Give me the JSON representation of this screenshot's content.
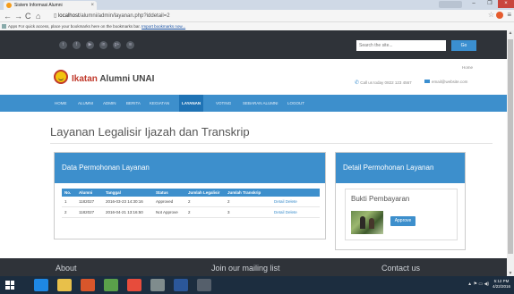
{
  "browser": {
    "tab_title": "Sistem Informasi Alumni",
    "tab_close": "×",
    "win_min": "–",
    "win_max": "❐",
    "win_close": "×",
    "url_host": "localhost",
    "url_path": "/alumni/admin/layanan.php?iddetail=2",
    "bookmarks_text": "For quick access, place your bookmarks here on the bookmarks bar.",
    "bookmarks_link": "Import bookmarks now...",
    "apps_label": "Apps"
  },
  "topbar": {
    "social_icons": [
      "twitter-icon",
      "facebook-icon",
      "youtube-icon",
      "linkedin-icon",
      "googleplus-icon",
      "rss-icon"
    ],
    "social_glyphs": [
      "t",
      "f",
      "▶",
      "in",
      "g+",
      "≋"
    ],
    "search_placeholder": "Search the site...",
    "search_button": "Go"
  },
  "header": {
    "brand_first": "Ikatan",
    "brand_rest": " Alumni UNAI",
    "home_label": "Home",
    "contact_text": "Call us today 0822 123 4567",
    "email_text": "email@website.com"
  },
  "nav": {
    "items": [
      {
        "label": "HOME"
      },
      {
        "label": "ALUMNI"
      },
      {
        "label": "ADMIN"
      },
      {
        "label": "BERITA"
      },
      {
        "label": "KEGIATAN"
      },
      {
        "label": "LAYANAN",
        "active": true
      },
      {
        "label": "VOTING"
      },
      {
        "label": "SEBARAN ALUMNI"
      },
      {
        "label": "LOGOUT"
      }
    ]
  },
  "page": {
    "title": "Layanan Legalisir Ijazah dan Transkrip"
  },
  "requests": {
    "heading": "Data Permohonan Layanan",
    "columns": [
      "No.",
      "Alumni",
      "Tanggal",
      "Status",
      "Jumlah Legalisir",
      "Jumlah Transkrip",
      ""
    ],
    "rows": [
      [
        "1",
        "1182027",
        "2016-03-23 14:30:16",
        "Approved",
        "2",
        "2",
        "Detail Delete"
      ],
      [
        "2",
        "1182027",
        "2016-04-21 13:16:50",
        "Not Approve",
        "2",
        "3",
        "Detail Delete"
      ]
    ]
  },
  "detail": {
    "heading": "Detail Permohonan Layanan",
    "bukti_title": "Bukti Pembayaran",
    "approve_button": "Approve"
  },
  "footer": {
    "about": "About",
    "mailing": "Join our mailing list",
    "contact": "Contact us"
  },
  "taskbar": {
    "tray_text": "▲ ⚑ ▭ ◀)",
    "time": "5:12 PM",
    "date": "4/22/2016"
  }
}
